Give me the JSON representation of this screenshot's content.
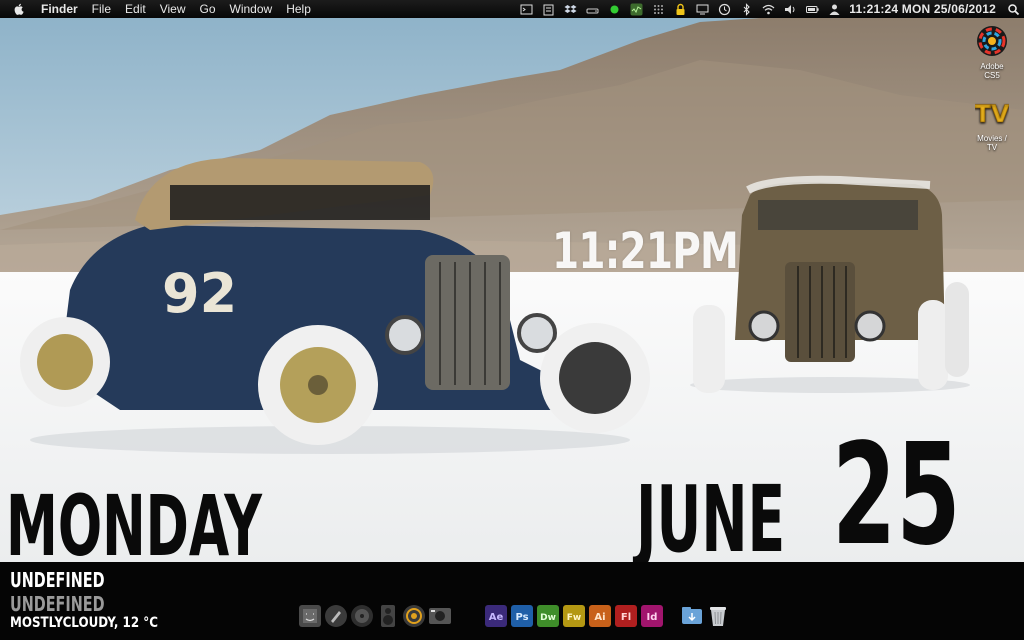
{
  "menubar": {
    "app_name": "Finder",
    "items": [
      "File",
      "Edit",
      "View",
      "Go",
      "Window",
      "Help"
    ],
    "clock": "11:21:24  MON 25/06/2012"
  },
  "desktop_icons": [
    {
      "label_line1": "Adobe",
      "label_line2": "CS5",
      "icon": "adobe-cs5-icon"
    },
    {
      "label_line1": "Movies /",
      "label_line2": "TV",
      "icon": "tv-folder-icon"
    }
  ],
  "widget": {
    "time": "11:21PM",
    "day": "MONDAY",
    "month": "JUNE",
    "date": "25"
  },
  "weather": {
    "line1": "UNDEFINED",
    "line2": "UNDEFINED",
    "condition": "MOSTLYCLOUDY, 12 °C"
  },
  "colors": {
    "menubar": "#0a0a0a",
    "strip": "#050505",
    "sky": "#9fbfd3",
    "salt_flat": "#f4f4f4"
  }
}
